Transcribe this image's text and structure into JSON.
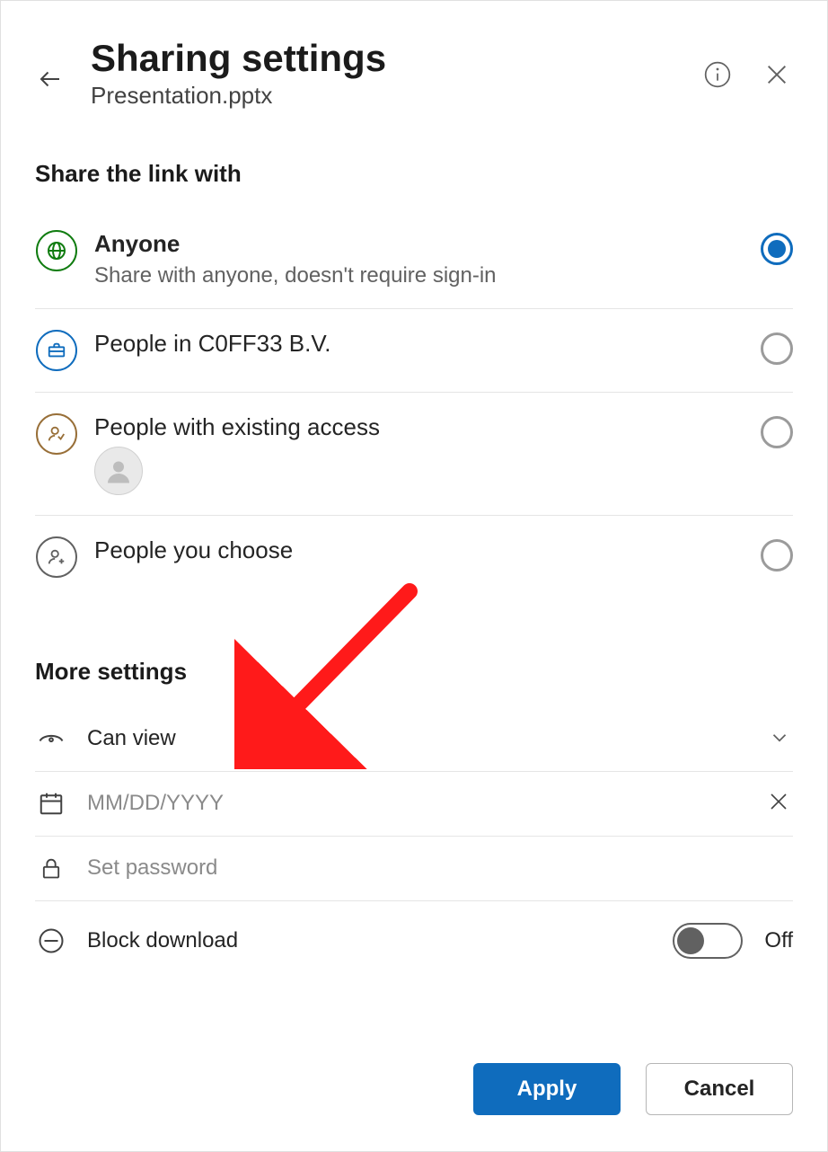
{
  "header": {
    "title": "Sharing settings",
    "filename": "Presentation.pptx"
  },
  "section_share_with": "Share the link with",
  "options": [
    {
      "title": "Anyone",
      "subtitle": "Share with anyone, doesn't require sign-in",
      "selected": true
    },
    {
      "title": "People in C0FF33 B.V.",
      "subtitle": "",
      "selected": false
    },
    {
      "title": "People with existing access",
      "subtitle": "",
      "selected": false
    },
    {
      "title": "People you choose",
      "subtitle": "",
      "selected": false
    }
  ],
  "section_more": "More settings",
  "permission": {
    "label": "Can view"
  },
  "date": {
    "value": "",
    "placeholder": "MM/DD/YYYY"
  },
  "password": {
    "value": "",
    "placeholder": "Set password"
  },
  "block_download": {
    "label": "Block download",
    "state_label": "Off"
  },
  "buttons": {
    "apply": "Apply",
    "cancel": "Cancel"
  }
}
